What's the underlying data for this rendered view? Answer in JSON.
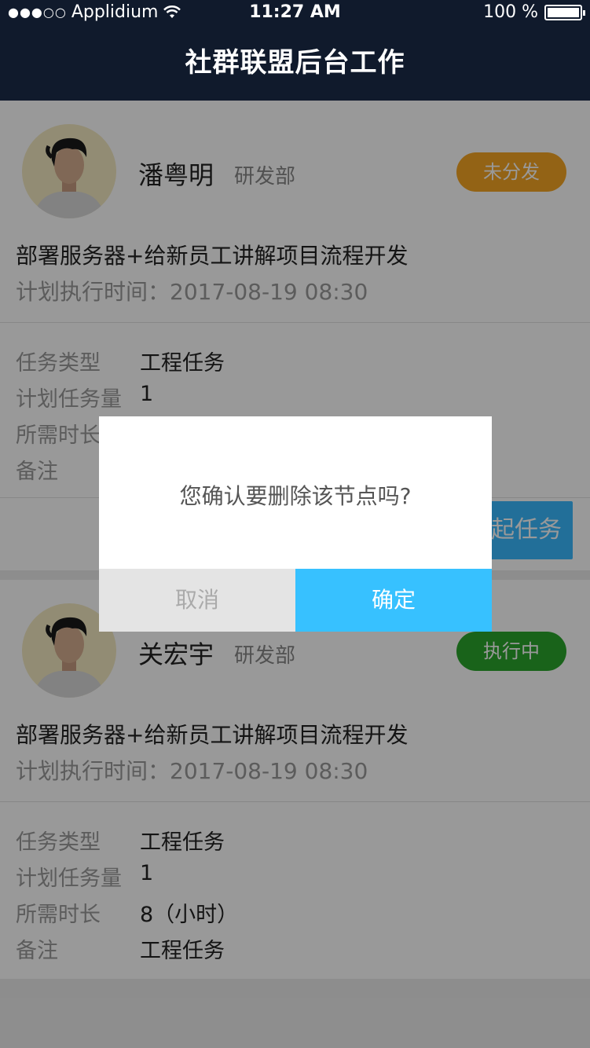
{
  "status": {
    "signal": "●●●○○",
    "carrier": "Applidium",
    "time": "11:27 AM",
    "battery": "100 %"
  },
  "nav": {
    "title": "社群联盟后台工作"
  },
  "cards": [
    {
      "name": "潘粤明",
      "dept": "研发部",
      "badge": "未分发",
      "badge_color": "#f5a623",
      "task_title": "部署服务器+给新员工讲解项目流程开发",
      "task_time": "计划执行时间：2017-08-19   08:30",
      "details": [
        {
          "label": "任务类型",
          "value": "工程任务"
        },
        {
          "label": "计划任务量",
          "value": "1"
        },
        {
          "label": "所需时长",
          "value": ""
        },
        {
          "label": "备注",
          "value": ""
        }
      ],
      "action_label": "发起任务"
    },
    {
      "name": "关宏宇",
      "dept": "研发部",
      "badge": "执行中",
      "badge_color": "#2aa52c",
      "task_title": "部署服务器+给新员工讲解项目流程开发",
      "task_time": "计划执行时间：2017-08-19   08:30",
      "details": [
        {
          "label": "任务类型",
          "value": "工程任务"
        },
        {
          "label": "计划任务量",
          "value": "1"
        },
        {
          "label": "所需时长",
          "value": "8（小时）"
        },
        {
          "label": "备注",
          "value": "工程任务"
        }
      ]
    }
  ],
  "dialog": {
    "message": "您确认要删除该节点吗?",
    "cancel": "取消",
    "confirm": "确定"
  }
}
